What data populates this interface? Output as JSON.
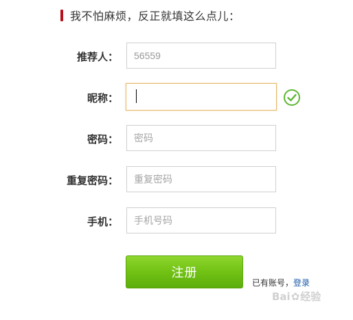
{
  "section": {
    "title": "我不怕麻烦，反正就填这么点儿："
  },
  "form": {
    "referrer": {
      "label": "推荐人：",
      "value": "56559"
    },
    "nickname": {
      "label": "昵称：",
      "value": ""
    },
    "password": {
      "label": "密码：",
      "placeholder": "密码"
    },
    "confirm_password": {
      "label": "重复密码：",
      "placeholder": "重复密码"
    },
    "phone": {
      "label": "手机：",
      "placeholder": "手机号码"
    }
  },
  "submit": {
    "label": "注册"
  },
  "login_prompt": {
    "text": "已有账号，",
    "link": "登录"
  },
  "watermark": {
    "text_left": "Bai",
    "text_right": "经验"
  },
  "colors": {
    "accent_bar": "#b5121b",
    "button_green": "#71c214",
    "check_green": "#5cb531",
    "focus_border": "#e7b868"
  },
  "icons": {
    "valid": "check-circle-icon",
    "watermark": "paw-icon"
  }
}
